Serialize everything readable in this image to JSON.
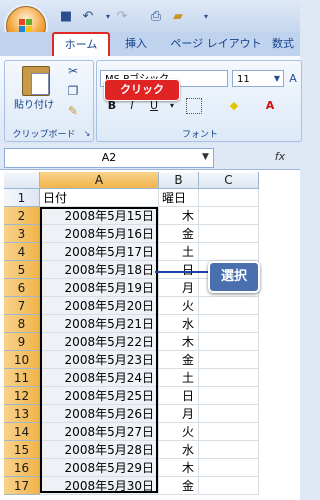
{
  "ribbon": {
    "tabs": [
      "ホーム",
      "挿入",
      "ページ レイアウト",
      "数式"
    ],
    "clipboard": {
      "paste_label": "貼り付け",
      "group_label": "クリップボード"
    },
    "font": {
      "name": "MS Pゴシック",
      "size": "11",
      "group_label": "フォント",
      "bold": "B",
      "italic": "I",
      "underline": "U",
      "font_color": "A"
    }
  },
  "callouts": {
    "click": "クリック",
    "select": "選択"
  },
  "formula_bar": {
    "name_box": "A2",
    "fx": "fx"
  },
  "grid": {
    "columns": [
      "A",
      "B",
      "C"
    ],
    "rows": [
      {
        "num": "1",
        "a": "日付",
        "b": "曜日"
      },
      {
        "num": "2",
        "a": "2008年5月15日",
        "b": "木"
      },
      {
        "num": "3",
        "a": "2008年5月16日",
        "b": "金"
      },
      {
        "num": "4",
        "a": "2008年5月17日",
        "b": "土"
      },
      {
        "num": "5",
        "a": "2008年5月18日",
        "b": "日"
      },
      {
        "num": "6",
        "a": "2008年5月19日",
        "b": "月"
      },
      {
        "num": "7",
        "a": "2008年5月20日",
        "b": "火"
      },
      {
        "num": "8",
        "a": "2008年5月21日",
        "b": "水"
      },
      {
        "num": "9",
        "a": "2008年5月22日",
        "b": "木"
      },
      {
        "num": "10",
        "a": "2008年5月23日",
        "b": "金"
      },
      {
        "num": "11",
        "a": "2008年5月24日",
        "b": "土"
      },
      {
        "num": "12",
        "a": "2008年5月25日",
        "b": "日"
      },
      {
        "num": "13",
        "a": "2008年5月26日",
        "b": "月"
      },
      {
        "num": "14",
        "a": "2008年5月27日",
        "b": "火"
      },
      {
        "num": "15",
        "a": "2008年5月28日",
        "b": "水"
      },
      {
        "num": "16",
        "a": "2008年5月29日",
        "b": "木"
      },
      {
        "num": "17",
        "a": "2008年5月30日",
        "b": "金"
      }
    ]
  },
  "colors": {
    "accent_red": "#e02323",
    "callout_blue": "#4a6fae",
    "row_header_selected": "#f1b44c"
  }
}
